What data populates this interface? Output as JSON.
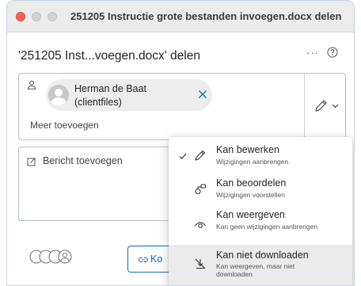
{
  "window": {
    "title": "251205 Instructie grote bestanden invoegen.docx delen"
  },
  "dialog": {
    "title": "'251205 Inst...voegen.docx' delen",
    "more_icon": "more-horizontal-icon",
    "help_icon": "question-icon"
  },
  "recipients": {
    "icon": "person-icon",
    "chip": {
      "name": "Herman de Baat",
      "subtitle": "(clientfiles)",
      "remove_icon": "close-icon",
      "remove_color": "#0f6cbd"
    },
    "add_more": "Meer toevoegen",
    "permission_icon": "pencil-icon",
    "permission_chevron": "chevron-down-icon"
  },
  "message": {
    "icon": "compose-icon",
    "placeholder": "Bericht toevoegen"
  },
  "footer": {
    "copy_label": "Ko",
    "copy_icon": "link-icon",
    "accent": "#0f6cbd"
  },
  "permission_menu": {
    "items": [
      {
        "title": "Kan bewerken",
        "description": "Wijzigingen aanbrengen",
        "icon": "pencil-icon",
        "checked": true
      },
      {
        "title": "Kan beoordelen",
        "description": "Wijzigingen voorstellen",
        "icon": "review-icon",
        "checked": false
      },
      {
        "title": "Kan weergeven",
        "description": "Kan geen wijzigingen aanbrengen",
        "icon": "eye-icon",
        "checked": false
      },
      {
        "title": "Kan niet downloaden",
        "description": "Kan weergeven, maar niet downloaden",
        "icon": "no-download-icon",
        "checked": false,
        "hovered": true
      }
    ]
  }
}
